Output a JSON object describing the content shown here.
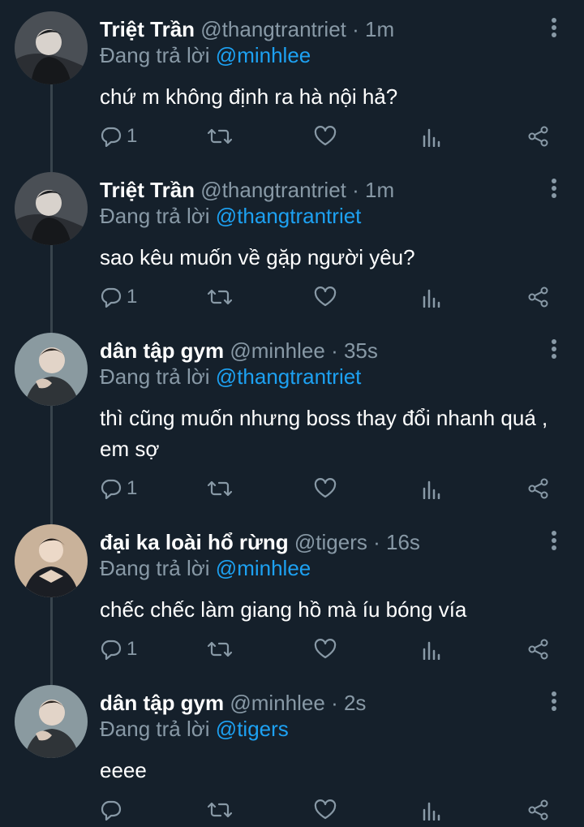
{
  "reply_prefix": "Đang trả lời",
  "colors": {
    "background": "#15202b",
    "secondary_text": "#8899a6",
    "mention": "#1da1f2",
    "thread_line": "#38444d"
  },
  "icons": [
    "more-vertical-icon",
    "reply-icon",
    "retweet-icon",
    "like-icon",
    "analytics-icon",
    "share-icon"
  ],
  "tweets": [
    {
      "name": "Triệt Trần",
      "handle": "@thangtrantriet",
      "sep": "·",
      "time": "1m",
      "reply_to": "@minhlee",
      "text": "chứ m không định ra hà nội hả?",
      "replies": "1"
    },
    {
      "name": "Triệt Trần",
      "handle": "@thangtrantriet",
      "sep": "·",
      "time": "1m",
      "reply_to": "@thangtrantriet",
      "text": "sao kêu muốn về gặp người yêu?",
      "replies": "1"
    },
    {
      "name": "dân tập gym",
      "handle": "@minhlee",
      "sep": "·",
      "time": "35s",
      "reply_to": "@thangtrantriet",
      "text": "thì cũng muốn nhưng boss thay đổi nhanh quá , em sợ",
      "replies": "1"
    },
    {
      "name": "đại ka loài hổ rừng",
      "handle": "@tigers",
      "sep": "·",
      "time": "16s",
      "reply_to": "@minhlee",
      "text": "chếc chếc làm giang hồ mà íu bóng vía",
      "replies": "1"
    },
    {
      "name": "dân tập gym",
      "handle": "@minhlee",
      "sep": "·",
      "time": "2s",
      "reply_to": "@tigers",
      "text": "eeee",
      "replies": ""
    }
  ]
}
